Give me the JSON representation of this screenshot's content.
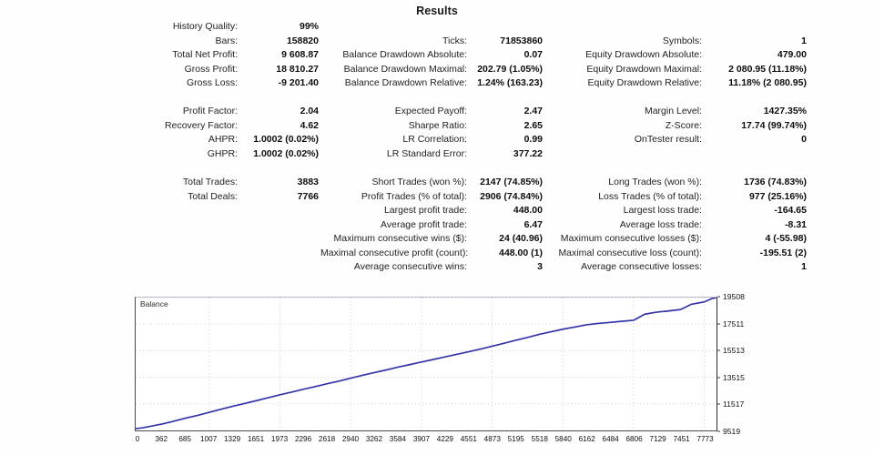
{
  "report": {
    "title": "Results"
  },
  "accent_colors": {
    "balance_line": "#3434a8",
    "grid": "#c9c9d6",
    "axis": "#454545",
    "background": "#fefefe"
  },
  "stats": {
    "group1": {
      "column_a": [
        {
          "label": "History Quality:",
          "value": "99%"
        },
        {
          "label": "Bars:",
          "value": "158820"
        },
        {
          "label": "Total Net Profit:",
          "value": "9 608.87"
        },
        {
          "label": "Gross Profit:",
          "value": "18 810.27"
        },
        {
          "label": "Gross Loss:",
          "value": "-9 201.40"
        }
      ],
      "column_b": [
        {
          "label": "",
          "value": ""
        },
        {
          "label": "Ticks:",
          "value": "71853860"
        },
        {
          "label": "Balance Drawdown Absolute:",
          "value": "0.07"
        },
        {
          "label": "Balance Drawdown Maximal:",
          "value": "202.79 (1.05%)"
        },
        {
          "label": "Balance Drawdown Relative:",
          "value": "1.24% (163.23)"
        }
      ],
      "column_c": [
        {
          "label": "",
          "value": ""
        },
        {
          "label": "Symbols:",
          "value": "1"
        },
        {
          "label": "Equity Drawdown Absolute:",
          "value": "479.00"
        },
        {
          "label": "Equity Drawdown Maximal:",
          "value": "2 080.95 (11.18%)"
        },
        {
          "label": "Equity Drawdown Relative:",
          "value": "11.18% (2 080.95)"
        }
      ]
    },
    "group2": {
      "column_a": [
        {
          "label": "Profit Factor:",
          "value": "2.04"
        },
        {
          "label": "Recovery Factor:",
          "value": "4.62"
        },
        {
          "label": "AHPR:",
          "value": "1.0002 (0.02%)"
        },
        {
          "label": "GHPR:",
          "value": "1.0002 (0.02%)"
        }
      ],
      "column_b": [
        {
          "label": "Expected Payoff:",
          "value": "2.47"
        },
        {
          "label": "Sharpe Ratio:",
          "value": "2.65"
        },
        {
          "label": "LR Correlation:",
          "value": "0.99"
        },
        {
          "label": "LR Standard Error:",
          "value": "377.22"
        }
      ],
      "column_c": [
        {
          "label": "Margin Level:",
          "value": "1427.35%"
        },
        {
          "label": "Z-Score:",
          "value": "17.74 (99.74%)"
        },
        {
          "label": "OnTester result:",
          "value": "0"
        },
        {
          "label": "",
          "value": ""
        }
      ]
    },
    "group3": {
      "column_a": [
        {
          "label": "Total Trades:",
          "value": "3883"
        },
        {
          "label": "Total Deals:",
          "value": "7766"
        },
        {
          "label": "",
          "value": ""
        },
        {
          "label": "",
          "value": ""
        },
        {
          "label": "",
          "value": ""
        },
        {
          "label": "",
          "value": ""
        },
        {
          "label": "",
          "value": ""
        }
      ],
      "column_b": [
        {
          "label": "Short Trades (won %):",
          "value": "2147 (74.85%)"
        },
        {
          "label": "Profit Trades (% of total):",
          "value": "2906 (74.84%)"
        },
        {
          "label": "Largest profit trade:",
          "value": "448.00"
        },
        {
          "label": "Average profit trade:",
          "value": "6.47"
        },
        {
          "label": "Maximum consecutive wins ($):",
          "value": "24 (40.96)"
        },
        {
          "label": "Maximal consecutive profit (count):",
          "value": "448.00 (1)"
        },
        {
          "label": "Average consecutive wins:",
          "value": "3"
        }
      ],
      "column_c": [
        {
          "label": "Long Trades (won %):",
          "value": "1736 (74.83%)"
        },
        {
          "label": "Loss Trades (% of total):",
          "value": "977 (25.16%)"
        },
        {
          "label": "Largest loss trade:",
          "value": "-164.65"
        },
        {
          "label": "Average loss trade:",
          "value": "-8.31"
        },
        {
          "label": "Maximum consecutive losses ($):",
          "value": "4 (-55.98)"
        },
        {
          "label": "Maximal consecutive loss (count):",
          "value": "-195.51 (2)"
        },
        {
          "label": "Average consecutive losses:",
          "value": "1"
        }
      ]
    }
  },
  "chart_data": {
    "type": "line",
    "title": "",
    "series_label": "Balance",
    "xlabel": "",
    "ylabel": "",
    "grid": true,
    "legend_position": "top-left-inline",
    "line_color": "#3434a8",
    "xlim": [
      0,
      7940
    ],
    "ylim": [
      9519,
      19508
    ],
    "yticks": [
      9519,
      11517,
      13515,
      15513,
      17511,
      19508
    ],
    "xticks": [
      0,
      362,
      685,
      1007,
      1329,
      1651,
      1973,
      2296,
      2618,
      2940,
      3262,
      3584,
      3907,
      4229,
      4551,
      4873,
      5195,
      5518,
      5840,
      6162,
      6484,
      6806,
      7129,
      7451,
      7773
    ],
    "x": [
      0,
      100,
      250,
      362,
      500,
      685,
      850,
      1007,
      1180,
      1329,
      1500,
      1651,
      1800,
      1973,
      2130,
      2296,
      2450,
      2618,
      2780,
      2940,
      3100,
      3262,
      3420,
      3584,
      3750,
      3907,
      4050,
      4229,
      4380,
      4551,
      4700,
      4873,
      5020,
      5195,
      5350,
      5518,
      5680,
      5840,
      6000,
      6162,
      6320,
      6484,
      6640,
      6806,
      6960,
      7129,
      7280,
      7451,
      7600,
      7773,
      7880,
      7940
    ],
    "y": [
      9650,
      9720,
      9880,
      10000,
      10180,
      10450,
      10650,
      10880,
      11130,
      11340,
      11560,
      11760,
      11960,
      12200,
      12400,
      12620,
      12810,
      13030,
      13230,
      13450,
      13660,
      13870,
      14060,
      14280,
      14470,
      14660,
      14830,
      15050,
      15230,
      15430,
      15620,
      15850,
      16050,
      16300,
      16500,
      16740,
      16940,
      17130,
      17290,
      17460,
      17560,
      17640,
      17720,
      17800,
      18260,
      18420,
      18500,
      18610,
      19010,
      19180,
      19440,
      19508
    ]
  }
}
